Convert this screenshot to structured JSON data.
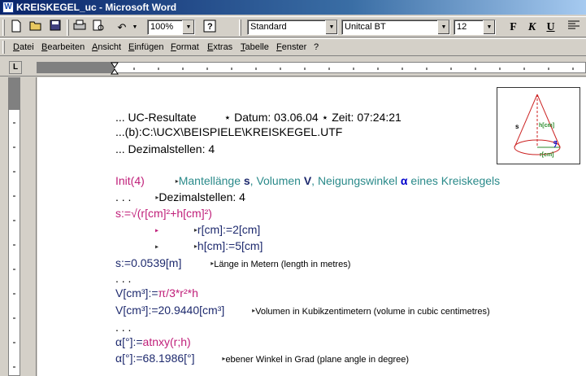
{
  "window": {
    "title": "KREISKEGEL_uc - Microsoft Word"
  },
  "toolbar": {
    "zoom": "100%",
    "style": "Standard",
    "font": "Unitcal BT",
    "size": "12",
    "bold_label": "F",
    "italic_label": "K",
    "underline_label": "U"
  },
  "menu": [
    "Datei",
    "Bearbeiten",
    "Ansicht",
    "Einfügen",
    "Format",
    "Extras",
    "Tabelle",
    "Fenster",
    "?"
  ],
  "ruler": {
    "tab_selector": "L"
  },
  "doc": {
    "l1_a": "... UC-Resultate",
    "l1_b": "Datum: 03.06.04",
    "l1_c": "Zeit: 07:24:21",
    "l2": "...(b):C:\\UCX\\BEISPIELE\\KREISKEGEL.UTF",
    "l3": "... Dezimalstellen: 4",
    "l4_init": "Init(4)",
    "l4_a": "Mantellänge ",
    "l4_s": "s",
    "l4_b": ", Volumen ",
    "l4_v": "V",
    "l4_c": ", Neigungswinkel ",
    "l4_alpha": "α",
    "l4_d": " eines Kreiskegels",
    "l5_dots": ". . .",
    "l5_text": "Dezimalstellen: 4",
    "l6_lhs": "s:=",
    "l6_rhs": "√(r[cm]²+h[cm]²)",
    "l7": "r[cm]:=2[cm]",
    "l8": "h[cm]:=5[cm]",
    "l9_res": "s:=0.0539[m]",
    "l9_note": "Länge in Metern (length in metres)",
    "l10": ". . .",
    "l11_lhs": "V[cm³]:=",
    "l11_rhs": "π/3*r²*h",
    "l12_lhs": "V[cm³]:=",
    "l12_res": "20.9440[cm³]",
    "l12_note": "Volumen in Kubikzentimetern (volume in cubic centimetres)",
    "l13": ". . .",
    "l14_lhs": "α[°]:=",
    "l14_rhs": "atnxy(r;h)",
    "l15_lhs": "α[°]:=",
    "l15_res": "68.1986[°]",
    "l15_note": "ebener Winkel in Grad (plane angle in degree)"
  },
  "figure": {
    "s_label": "s",
    "h_label": "h[cm]",
    "r_label": "r[cm]",
    "alpha_label": "α"
  }
}
